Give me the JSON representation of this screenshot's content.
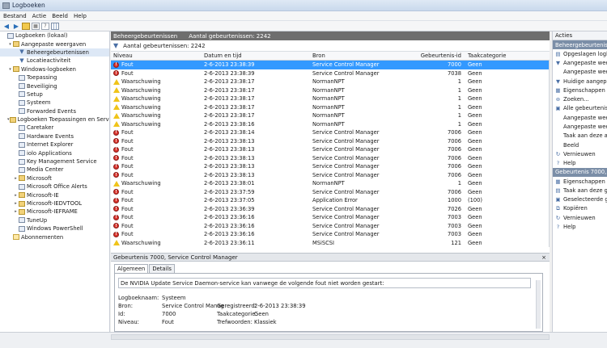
{
  "window": {
    "title": "Logboeken"
  },
  "menu": [
    "Bestand",
    "Actie",
    "Beeld",
    "Help"
  ],
  "toolbar": {
    "icons": [
      "back-arrow-icon",
      "forward-arrow-icon",
      "folder-icon",
      "properties-icon",
      "help-icon",
      "grid-icon"
    ]
  },
  "tree": [
    {
      "label": "Logboeken (lokaal)",
      "indent": 0,
      "icon": "log",
      "exp": ""
    },
    {
      "label": "Aangepaste weergaven",
      "indent": 1,
      "icon": "folder",
      "exp": "▾"
    },
    {
      "label": "Beheergebeurtenissen",
      "indent": 2,
      "icon": "filter",
      "exp": "",
      "selected": true
    },
    {
      "label": "Locatieactiviteit",
      "indent": 2,
      "icon": "filter",
      "exp": ""
    },
    {
      "label": "Windows-logboeken",
      "indent": 1,
      "icon": "folder",
      "exp": "▾"
    },
    {
      "label": "Toepassing",
      "indent": 2,
      "icon": "log",
      "exp": ""
    },
    {
      "label": "Beveiliging",
      "indent": 2,
      "icon": "log",
      "exp": ""
    },
    {
      "label": "Setup",
      "indent": 2,
      "icon": "log",
      "exp": ""
    },
    {
      "label": "Systeem",
      "indent": 2,
      "icon": "log",
      "exp": ""
    },
    {
      "label": "Forwarded Events",
      "indent": 2,
      "icon": "log",
      "exp": ""
    },
    {
      "label": "Logboeken Toepassingen en Services",
      "indent": 1,
      "icon": "folder",
      "exp": "▾"
    },
    {
      "label": "Caretaker",
      "indent": 2,
      "icon": "log",
      "exp": ""
    },
    {
      "label": "Hardware Events",
      "indent": 2,
      "icon": "log",
      "exp": ""
    },
    {
      "label": "Internet Explorer",
      "indent": 2,
      "icon": "log",
      "exp": ""
    },
    {
      "label": "iolo Applications",
      "indent": 2,
      "icon": "log",
      "exp": ""
    },
    {
      "label": "Key Management Service",
      "indent": 2,
      "icon": "log",
      "exp": ""
    },
    {
      "label": "Media Center",
      "indent": 2,
      "icon": "log",
      "exp": ""
    },
    {
      "label": "Microsoft",
      "indent": 2,
      "icon": "folder",
      "exp": "▸"
    },
    {
      "label": "Microsoft Office Alerts",
      "indent": 2,
      "icon": "log",
      "exp": ""
    },
    {
      "label": "Microsoft-IE",
      "indent": 2,
      "icon": "folder",
      "exp": "▸"
    },
    {
      "label": "Microsoft-IEDVTOOL",
      "indent": 2,
      "icon": "folder",
      "exp": "▸"
    },
    {
      "label": "Microsoft-IEFRAME",
      "indent": 2,
      "icon": "folder",
      "exp": "▸"
    },
    {
      "label": "TuneUp",
      "indent": 2,
      "icon": "log",
      "exp": ""
    },
    {
      "label": "Windows PowerShell",
      "indent": 2,
      "icon": "log",
      "exp": ""
    },
    {
      "label": "Abonnementen",
      "indent": 1,
      "icon": "sub",
      "exp": ""
    }
  ],
  "center": {
    "header_title": "Beheergebeurtenissen",
    "header_count": "Aantal gebeurtenissen: 2242",
    "filter_text": "Aantal gebeurtenissen: 2242",
    "columns": [
      "Niveau",
      "Datum en tijd",
      "Bron",
      "Gebeurtenis-id",
      "Taakcategorie"
    ],
    "rows": [
      {
        "level": "Fout",
        "type": "err",
        "date": "2-6-2013 23:38:39",
        "source": "Service Control Manager",
        "id": "7000",
        "cat": "Geen",
        "selected": true
      },
      {
        "level": "Fout",
        "type": "err",
        "date": "2-6-2013 23:38:39",
        "source": "Service Control Manager",
        "id": "7038",
        "cat": "Geen"
      },
      {
        "level": "Waarschuwing",
        "type": "warn",
        "date": "2-6-2013 23:38:17",
        "source": "NormanNPT",
        "id": "1",
        "cat": "Geen"
      },
      {
        "level": "Waarschuwing",
        "type": "warn",
        "date": "2-6-2013 23:38:17",
        "source": "NormanNPT",
        "id": "1",
        "cat": "Geen"
      },
      {
        "level": "Waarschuwing",
        "type": "warn",
        "date": "2-6-2013 23:38:17",
        "source": "NormanNPT",
        "id": "1",
        "cat": "Geen"
      },
      {
        "level": "Waarschuwing",
        "type": "warn",
        "date": "2-6-2013 23:38:17",
        "source": "NormanNPT",
        "id": "1",
        "cat": "Geen"
      },
      {
        "level": "Waarschuwing",
        "type": "warn",
        "date": "2-6-2013 23:38:17",
        "source": "NormanNPT",
        "id": "1",
        "cat": "Geen"
      },
      {
        "level": "Waarschuwing",
        "type": "warn",
        "date": "2-6-2013 23:38:16",
        "source": "NormanNPT",
        "id": "1",
        "cat": "Geen"
      },
      {
        "level": "Fout",
        "type": "err",
        "date": "2-6-2013 23:38:14",
        "source": "Service Control Manager",
        "id": "7006",
        "cat": "Geen"
      },
      {
        "level": "Fout",
        "type": "err",
        "date": "2-6-2013 23:38:13",
        "source": "Service Control Manager",
        "id": "7006",
        "cat": "Geen"
      },
      {
        "level": "Fout",
        "type": "err",
        "date": "2-6-2013 23:38:13",
        "source": "Service Control Manager",
        "id": "7006",
        "cat": "Geen"
      },
      {
        "level": "Fout",
        "type": "err",
        "date": "2-6-2013 23:38:13",
        "source": "Service Control Manager",
        "id": "7006",
        "cat": "Geen"
      },
      {
        "level": "Fout",
        "type": "err",
        "date": "2-6-2013 23:38:13",
        "source": "Service Control Manager",
        "id": "7006",
        "cat": "Geen"
      },
      {
        "level": "Fout",
        "type": "err",
        "date": "2-6-2013 23:38:13",
        "source": "Service Control Manager",
        "id": "7006",
        "cat": "Geen"
      },
      {
        "level": "Waarschuwing",
        "type": "warn",
        "date": "2-6-2013 23:38:01",
        "source": "NormanNPT",
        "id": "1",
        "cat": "Geen"
      },
      {
        "level": "Fout",
        "type": "err",
        "date": "2-6-2013 23:37:59",
        "source": "Service Control Manager",
        "id": "7006",
        "cat": "Geen"
      },
      {
        "level": "Fout",
        "type": "err",
        "date": "2-6-2013 23:37:05",
        "source": "Application Error",
        "id": "1000",
        "cat": "(100)"
      },
      {
        "level": "Fout",
        "type": "err",
        "date": "2-6-2013 23:36:39",
        "source": "Service Control Manager",
        "id": "7026",
        "cat": "Geen"
      },
      {
        "level": "Fout",
        "type": "err",
        "date": "2-6-2013 23:36:16",
        "source": "Service Control Manager",
        "id": "7003",
        "cat": "Geen"
      },
      {
        "level": "Fout",
        "type": "err",
        "date": "2-6-2013 23:36:16",
        "source": "Service Control Manager",
        "id": "7003",
        "cat": "Geen"
      },
      {
        "level": "Fout",
        "type": "err",
        "date": "2-6-2013 23:36:16",
        "source": "Service Control Manager",
        "id": "7003",
        "cat": "Geen"
      },
      {
        "level": "Waarschuwing",
        "type": "warn",
        "date": "2-6-2013 23:36:11",
        "source": "MSiSCSI",
        "id": "121",
        "cat": "Geen"
      }
    ]
  },
  "detail": {
    "title": "Gebeurtenis 7000, Service Control Manager",
    "close": "×",
    "tabs": [
      "Algemeen",
      "Details"
    ],
    "description": "De NVIDIA Update Service Daemon-service kan vanwege de volgende fout niet worden gestart:",
    "fields": {
      "logname_label": "Logboeknaam:",
      "logname_value": "Systeem",
      "source_label": "Bron:",
      "source_value": "Service Control Manag",
      "registered_label": "Geregistreerd:",
      "registered_value": "2-6-2013 23:38:39",
      "id_label": "Id:",
      "id_value": "7000",
      "taskcat_label": "Taakcategorie:",
      "taskcat_value": "Geen",
      "level_label": "Niveau:",
      "level_value": "Fout",
      "keywords_label": "Trefwoorden:",
      "keywords_value": "Klassiek"
    }
  },
  "actions": {
    "header": "Acties",
    "section1": "Beheergebeurtenissen",
    "items1": [
      {
        "label": "Opgeslagen logboe",
        "icon": "open-icon",
        "glyph": "▤"
      },
      {
        "label": "Aangepaste weerg",
        "icon": "filter-icon",
        "glyph": "▼"
      },
      {
        "label": "Aangepaste weerg",
        "icon": "blank",
        "glyph": ""
      },
      {
        "label": "Huidige aangepast",
        "icon": "filter-icon",
        "glyph": "▼"
      },
      {
        "label": "Eigenschappen",
        "icon": "properties-icon",
        "glyph": "▦"
      },
      {
        "label": "Zoeken...",
        "icon": "binoculars-icon",
        "glyph": "⊚"
      },
      {
        "label": "Alle gebeurtenissen",
        "icon": "save-icon",
        "glyph": "▣"
      },
      {
        "label": "Aangepaste weerg",
        "icon": "blank",
        "glyph": ""
      },
      {
        "label": "Aangepaste weerg",
        "icon": "blank",
        "glyph": ""
      },
      {
        "label": "Taak aan deze aang",
        "icon": "blank",
        "glyph": ""
      },
      {
        "label": "Beeld",
        "icon": "blank",
        "glyph": ""
      },
      {
        "label": "Vernieuwen",
        "icon": "refresh-icon",
        "glyph": "↻"
      },
      {
        "label": "Help",
        "icon": "help-icon",
        "glyph": "?"
      }
    ],
    "section2": "Gebeurtenis 7000, Service",
    "items2": [
      {
        "label": "Eigenschappen van",
        "icon": "properties-icon",
        "glyph": "▦"
      },
      {
        "label": "Taak aan deze geb",
        "icon": "task-icon",
        "glyph": "▤"
      },
      {
        "label": "Geselecteerde geb",
        "icon": "save-icon",
        "glyph": "▣"
      },
      {
        "label": "Kopiëren",
        "icon": "copy-icon",
        "glyph": "⧉"
      },
      {
        "label": "Vernieuwen",
        "icon": "refresh-icon",
        "glyph": "↻"
      },
      {
        "label": "Help",
        "icon": "help-icon",
        "glyph": "?"
      }
    ]
  }
}
